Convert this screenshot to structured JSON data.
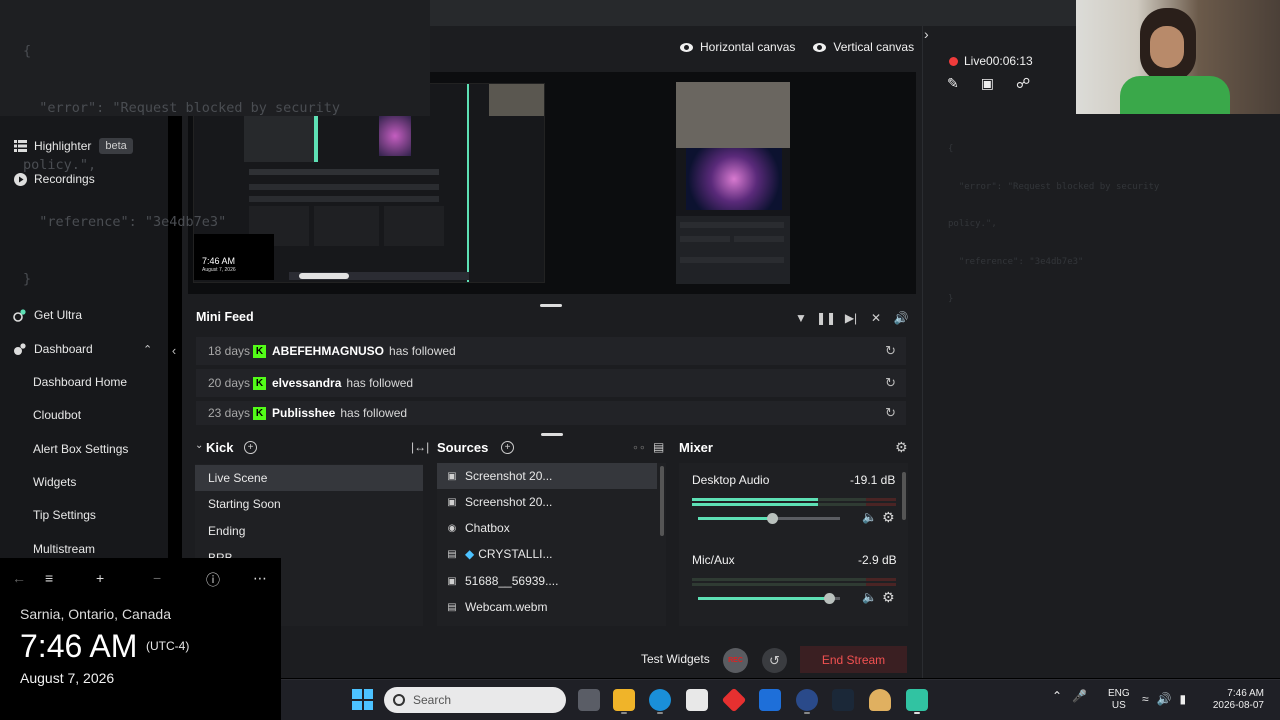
{
  "overlay_json": {
    "lines": [
      "{",
      "  \"error\": \"Request blocked by security",
      "policy.\",",
      "  \"reference\": \"3e4db7e3\"",
      "}"
    ]
  },
  "sidebar": {
    "highlighter": "Highlighter",
    "highlighter_badge": "beta",
    "recordings": "Recordings",
    "get_ultra": "Get Ultra",
    "dashboard": "Dashboard",
    "items": [
      "Dashboard Home",
      "Cloudbot",
      "Alert Box Settings",
      "Widgets",
      "Tip Settings",
      "Multistream"
    ]
  },
  "canvas": {
    "horizontal": "Horizontal canvas",
    "vertical": "Vertical canvas"
  },
  "preview_left": {
    "time": "7:46 AM",
    "date": "August 7, 2026"
  },
  "mini_feed": {
    "title": "Mini Feed",
    "rows": [
      {
        "days": "18 days",
        "name": "ABEFEHMAGNUSO",
        "action": "has followed"
      },
      {
        "days": "20 days",
        "name": "elvessandra",
        "action": "has followed"
      },
      {
        "days": "23 days",
        "name": "Publisshee",
        "action": "has followed"
      }
    ]
  },
  "scenes": {
    "title": "Kick",
    "items": [
      "Live Scene",
      "Starting Soon",
      "Ending",
      "BRB"
    ]
  },
  "sources": {
    "title": "Sources",
    "items": [
      "Screenshot 20...",
      "Screenshot 20...",
      "Chatbox",
      "CRYSTALLI...",
      "51688__56939....",
      "Webcam.webm"
    ]
  },
  "mixer": {
    "title": "Mixer",
    "channels": [
      {
        "name": "Desktop Audio",
        "db": "-19.1 dB",
        "level": 0.62,
        "volume": 0.52
      },
      {
        "name": "Mic/Aux",
        "db": "-2.9 dB",
        "level": 0.0,
        "volume": 0.92
      }
    ]
  },
  "footer": {
    "test_widgets": "Test Widgets",
    "rec": "REC",
    "end_stream": "End Stream"
  },
  "live": {
    "status": "Live",
    "timer": "00:06:13"
  },
  "clock_widget": {
    "location": "Sarnia, Ontario, Canada",
    "time": "7:46 AM",
    "tz": "(UTC-4)",
    "date": "August 7, 2026"
  },
  "taskbar": {
    "search_placeholder": "Search",
    "lang1": "ENG",
    "lang2": "US",
    "time": "7:46 AM",
    "date": "2026-08-07"
  },
  "colors": {
    "accent": "#5ee0b5",
    "kick_green": "#53fc18",
    "end_stream_text": "#f25151",
    "live_dot": "#ef3b3b"
  }
}
